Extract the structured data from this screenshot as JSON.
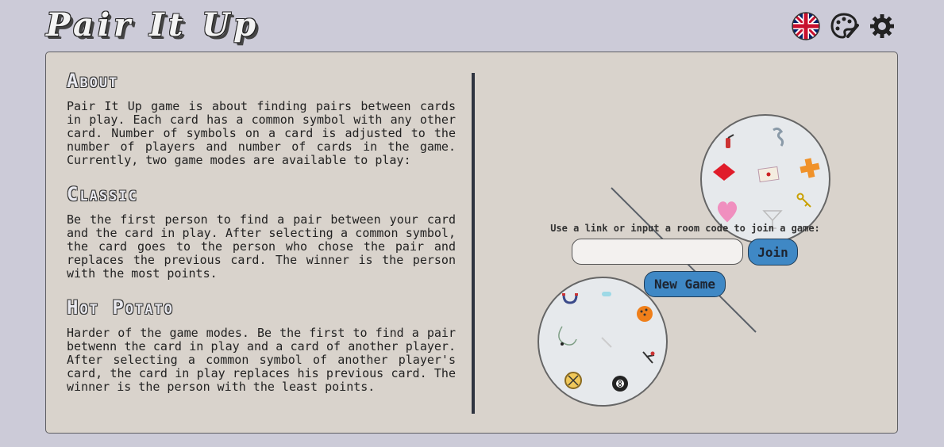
{
  "header": {
    "logo": "Pair It Up",
    "icons": [
      "uk-flag-icon",
      "palette-icon",
      "gear-icon"
    ]
  },
  "about": {
    "title": "About",
    "text": "Pair It Up game is about finding pairs between cards in play. Each card has a common symbol with any other card. Number of symbols on a card is adjusted to the number of players and number of cards in the game. Currently, two game modes are available to play:"
  },
  "classic": {
    "title": "Classic",
    "text": "Be the first person to find a pair between your card and the card in play. After selecting a common symbol, the card goes to the person who chose the pair and replaces the previous card. The winner is the person with the most points."
  },
  "hot_potato": {
    "title": "Hot Potato",
    "text": "Harder of the game modes. Be the first to find a pair betwenn the card in play and a card of another player. After selecting a common symbol of another player's card, the card in play replaces his previous card. The winner is the person with the least points."
  },
  "join": {
    "label": "Use a link or input a room code to join a game:",
    "input_value": "",
    "join_button": "Join",
    "new_game_button": "New Game"
  },
  "colors": {
    "background": "#cccbd8",
    "panel": "#d9d3cc",
    "button": "#3f88c5",
    "divider": "#2f3440"
  },
  "cards": {
    "top_card_symbols": [
      "fire-extinguisher-icon",
      "chain-icon",
      "diamond-icon",
      "envelope-icon",
      "plus-icon",
      "key-icon",
      "heart-icon",
      "cocktail-icon"
    ],
    "bottom_card_symbols": [
      "magnet-icon",
      "pills-icon",
      "orange-ball-icon",
      "cord-icon",
      "pencil-icon",
      "skier-icon",
      "compass-icon",
      "eight-ball-icon"
    ]
  }
}
